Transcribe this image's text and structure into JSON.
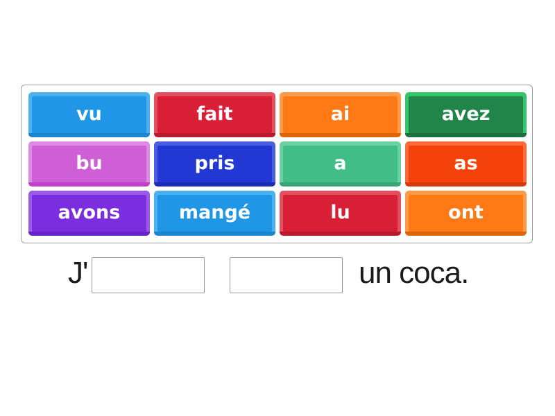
{
  "activity": {
    "tiles": [
      {
        "label": "vu",
        "color": "#1f97e6",
        "rim": "#49b1f0",
        "bottom": "#1a86cf"
      },
      {
        "label": "fait",
        "color": "#d81f36",
        "rim": "#e2505f",
        "bottom": "#b81a2e"
      },
      {
        "label": "ai",
        "color": "#ff7a14",
        "rim": "#ff9a48",
        "bottom": "#de6608"
      },
      {
        "label": "avez",
        "color": "#218549",
        "rim": "#34c46a",
        "bottom": "#1c703e"
      },
      {
        "label": "bu",
        "color": "#cf5fd6",
        "rim": "#de8ae2",
        "bottom": "#c040c8"
      },
      {
        "label": "pris",
        "color": "#2138d4",
        "rim": "#4a5fe0",
        "bottom": "#1a2cb4"
      },
      {
        "label": "a",
        "color": "#41be88",
        "rim": "#6bd0a3",
        "bottom": "#36a676"
      },
      {
        "label": "as",
        "color": "#f5420a",
        "rim": "#ff6a3a",
        "bottom": "#d8390a"
      },
      {
        "label": "avons",
        "color": "#7b2ee0",
        "rim": "#9a5ae8",
        "bottom": "#6622c8"
      },
      {
        "label": "mangé",
        "color": "#1f97e6",
        "rim": "#49b1f0",
        "bottom": "#1a86cf"
      },
      {
        "label": "lu",
        "color": "#d81f36",
        "rim": "#e2505f",
        "bottom": "#b81a2e"
      },
      {
        "label": "ont",
        "color": "#ff7a14",
        "rim": "#ff9a48",
        "bottom": "#de6608"
      }
    ],
    "sentence": {
      "prefix": "J'",
      "blank_1_value": "",
      "blank_2_value": "",
      "suffix": "un coca."
    }
  }
}
